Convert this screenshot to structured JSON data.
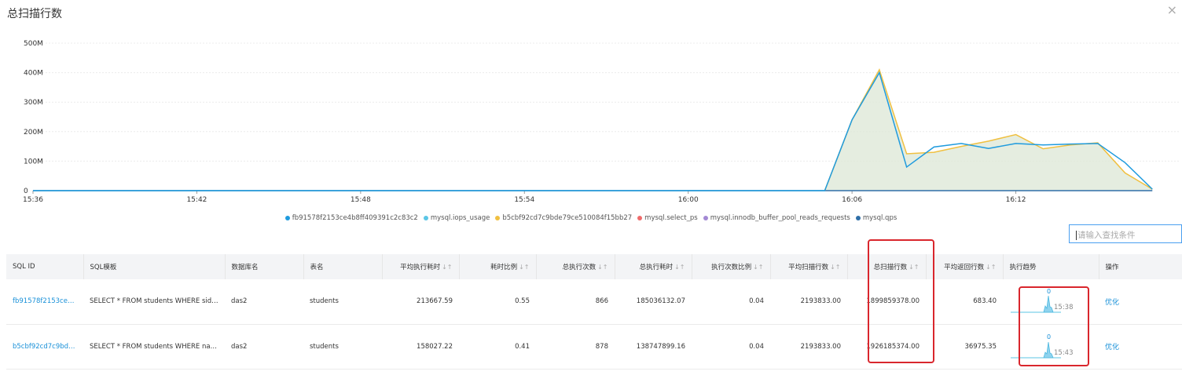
{
  "panel": {
    "title": "总扫描行数",
    "close_icon": "×"
  },
  "chart_data": {
    "type": "line",
    "title": "",
    "xlabel": "",
    "ylabel": "",
    "y_ticks": [
      "0",
      "100M",
      "200M",
      "300M",
      "400M",
      "500M"
    ],
    "ylim": [
      0,
      500
    ],
    "y_unit": "M",
    "x_ticks": [
      "15:36",
      "15:42",
      "15:48",
      "15:54",
      "16:00",
      "16:06",
      "16:12"
    ],
    "x_start": "15:36",
    "x_end": "16:18",
    "grid": true,
    "legend_position": "bottom",
    "series": [
      {
        "name": "fb91578f2153ce4b8ff409391c2c83c2",
        "color": "#1f9bde",
        "points": [
          [
            "15:36",
            0
          ],
          [
            "16:05",
            0
          ],
          [
            "16:06",
            240
          ],
          [
            "16:07",
            400
          ],
          [
            "16:08",
            80
          ],
          [
            "16:09",
            148
          ],
          [
            "16:10",
            160
          ],
          [
            "16:11",
            143
          ],
          [
            "16:12",
            160
          ],
          [
            "16:13",
            155
          ],
          [
            "16:14",
            158
          ],
          [
            "16:15",
            160
          ],
          [
            "16:16",
            95
          ],
          [
            "16:17",
            5
          ]
        ]
      },
      {
        "name": "mysql.iops_usage",
        "color": "#5bc6e6",
        "points": []
      },
      {
        "name": "b5cbf92cd7c9bde79ce510084f15bb27",
        "color": "#f0c040",
        "points": [
          [
            "16:05",
            0
          ],
          [
            "16:06",
            240
          ],
          [
            "16:07",
            410
          ],
          [
            "16:08",
            125
          ],
          [
            "16:09",
            130
          ],
          [
            "16:10",
            150
          ],
          [
            "16:11",
            168
          ],
          [
            "16:12",
            190
          ],
          [
            "16:13",
            142
          ],
          [
            "16:14",
            155
          ],
          [
            "16:15",
            162
          ],
          [
            "16:16",
            60
          ],
          [
            "16:17",
            5
          ]
        ]
      },
      {
        "name": "mysql.select_ps",
        "color": "#ef6b6b",
        "points": []
      },
      {
        "name": "mysql.innodb_buffer_pool_reads_requests",
        "color": "#a389d4",
        "points": []
      },
      {
        "name": "mysql.qps",
        "color": "#2f6fa7",
        "points": [
          [
            "15:36",
            0
          ],
          [
            "16:17",
            0
          ]
        ]
      }
    ]
  },
  "search": {
    "placeholder": "请输入查找条件"
  },
  "table": {
    "headers": {
      "sql_id": "SQL ID",
      "template": "SQL模板",
      "db": "数据库名",
      "table": "表名",
      "avg_time": "平均执行耗时",
      "time_ratio": "耗时比例",
      "exec_count": "总执行次数",
      "total_time": "总执行耗时",
      "count_ratio": "执行次数比例",
      "avg_scan": "平均扫描行数",
      "total_scan": "总扫描行数",
      "avg_return": "平均返回行数",
      "trend": "执行趋势",
      "action": "操作"
    },
    "sort_icon": "↓↑",
    "rows": [
      {
        "sql_id": "fb91578f2153ce4b...",
        "template": "SELECT * FROM students WHERE sid L...",
        "db": "das2",
        "table": "students",
        "avg_time": "213667.59",
        "time_ratio": "0.55",
        "exec_count": "866",
        "total_time": "185036132.07",
        "count_ratio": "0.04",
        "avg_scan": "2193833.00",
        "total_scan": "1899859378.00",
        "avg_return": "683.40",
        "trend_zero": "0",
        "trend_time": "15:38",
        "action": "优化"
      },
      {
        "sql_id": "b5cbf92cd7c9bde7...",
        "template": "SELECT * FROM students WHERE nam...",
        "db": "das2",
        "table": "students",
        "avg_time": "158027.22",
        "time_ratio": "0.41",
        "exec_count": "878",
        "total_time": "138747899.16",
        "count_ratio": "0.04",
        "avg_scan": "2193833.00",
        "total_scan": "1926185374.00",
        "avg_return": "36975.35",
        "trend_zero": "0",
        "trend_time": "15:43",
        "action": "优化"
      }
    ]
  },
  "colors": {
    "link": "#1890d8",
    "highlight": "#d9262d",
    "area_fill": "#dfe9d8"
  }
}
